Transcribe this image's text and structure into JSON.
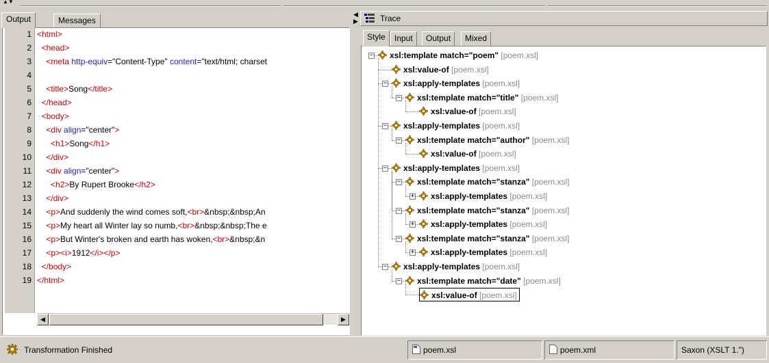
{
  "left_panel": {
    "tabs": [
      {
        "label": "Output",
        "active": true
      },
      {
        "label": "Messages",
        "active": false
      }
    ],
    "line_numbers": [
      "1",
      "2",
      "3",
      "4",
      "5",
      "6",
      "7",
      "8",
      "9",
      "10",
      "11",
      "12",
      "13",
      "14",
      "15",
      "16",
      "17",
      "18",
      "19"
    ],
    "code_lines": [
      [
        [
          "tg",
          "<html>"
        ]
      ],
      [
        [
          "tx",
          "  "
        ],
        [
          "tg",
          "<head>"
        ]
      ],
      [
        [
          "tx",
          "    "
        ],
        [
          "tg",
          "<meta "
        ],
        [
          "at",
          "http-equiv"
        ],
        [
          "tx",
          "=\"Content-Type\" "
        ],
        [
          "at",
          "content"
        ],
        [
          "tx",
          "=\"text/html; charset"
        ]
      ],
      [
        [
          "tx",
          ""
        ]
      ],
      [
        [
          "tx",
          "    "
        ],
        [
          "tg",
          "<title>"
        ],
        [
          "tx",
          "Song"
        ],
        [
          "tg",
          "</title>"
        ]
      ],
      [
        [
          "tx",
          "  "
        ],
        [
          "tg",
          "</head>"
        ]
      ],
      [
        [
          "tx",
          "  "
        ],
        [
          "tg",
          "<body>"
        ]
      ],
      [
        [
          "tx",
          "    "
        ],
        [
          "tg",
          "<div "
        ],
        [
          "at",
          "align"
        ],
        [
          "tx",
          "=\"center\""
        ],
        [
          "tg",
          ">"
        ]
      ],
      [
        [
          "tx",
          "      "
        ],
        [
          "tg",
          "<h1>"
        ],
        [
          "tx",
          "Song"
        ],
        [
          "tg",
          "</h1>"
        ]
      ],
      [
        [
          "tx",
          "    "
        ],
        [
          "tg",
          "</div>"
        ]
      ],
      [
        [
          "tx",
          "    "
        ],
        [
          "tg",
          "<div "
        ],
        [
          "at",
          "align"
        ],
        [
          "tx",
          "=\"center\""
        ],
        [
          "tg",
          ">"
        ]
      ],
      [
        [
          "tx",
          "      "
        ],
        [
          "tg",
          "<h2>"
        ],
        [
          "tx",
          "By Rupert Brooke"
        ],
        [
          "tg",
          "</h2>"
        ]
      ],
      [
        [
          "tx",
          "    "
        ],
        [
          "tg",
          "</div>"
        ]
      ],
      [
        [
          "tx",
          "    "
        ],
        [
          "tg",
          "<p>"
        ],
        [
          "tx",
          "And suddenly the wind comes soft,"
        ],
        [
          "tg",
          "<br>"
        ],
        [
          "tx",
          "&nbsp;&nbsp;An"
        ]
      ],
      [
        [
          "tx",
          "    "
        ],
        [
          "tg",
          "<p>"
        ],
        [
          "tx",
          "My heart all Winter lay so numb,"
        ],
        [
          "tg",
          "<br>"
        ],
        [
          "tx",
          "&nbsp;&nbsp;The e"
        ]
      ],
      [
        [
          "tx",
          "    "
        ],
        [
          "tg",
          "<p>"
        ],
        [
          "tx",
          "But Winter's broken and earth has woken,"
        ],
        [
          "tg",
          "<br>"
        ],
        [
          "tx",
          "&nbsp;&n"
        ]
      ],
      [
        [
          "tx",
          "    "
        ],
        [
          "tg",
          "<p><i>"
        ],
        [
          "tx",
          "1912"
        ],
        [
          "tg",
          "</i></p>"
        ]
      ],
      [
        [
          "tx",
          "  "
        ],
        [
          "tg",
          "</body>"
        ]
      ],
      [
        [
          "tg",
          "</html>"
        ]
      ]
    ],
    "scroll_left_icon": "scroll-left-icon",
    "scroll_right_icon": "scroll-right-icon"
  },
  "right_panel": {
    "title": "Trace",
    "title_icon": "trace-tree-icon",
    "tabs": [
      {
        "label": "Style",
        "active": true
      },
      {
        "label": "Input",
        "active": false
      },
      {
        "label": "Output",
        "active": false
      },
      {
        "label": "Mixed",
        "active": false
      }
    ],
    "tree": [
      {
        "depth": 0,
        "expander": "minus",
        "label": "xsl:template match=\"poem\"",
        "src": "[poem.xsl]"
      },
      {
        "depth": 1,
        "expander": "none",
        "label": "xsl:value-of",
        "src": "[poem.xsl]"
      },
      {
        "depth": 1,
        "expander": "minus",
        "label": "xsl:apply-templates",
        "src": "[poem.xsl]"
      },
      {
        "depth": 2,
        "expander": "minus",
        "label": "xsl:template match=\"title\"",
        "src": "[poem.xsl]"
      },
      {
        "depth": 3,
        "expander": "none",
        "label": "xsl:value-of",
        "src": "[poem.xsl]"
      },
      {
        "depth": 1,
        "expander": "minus",
        "label": "xsl:apply-templates",
        "src": "[poem.xsl]"
      },
      {
        "depth": 2,
        "expander": "minus",
        "label": "xsl:template match=\"author\"",
        "src": "[poem.xsl]"
      },
      {
        "depth": 3,
        "expander": "none",
        "label": "xsl:value-of",
        "src": "[poem.xsl]"
      },
      {
        "depth": 1,
        "expander": "minus",
        "label": "xsl:apply-templates",
        "src": "[poem.xsl]"
      },
      {
        "depth": 2,
        "expander": "minus",
        "label": "xsl:template match=\"stanza\"",
        "src": "[poem.xsl]"
      },
      {
        "depth": 3,
        "expander": "plus",
        "label": "xsl:apply-templates",
        "src": "[poem.xsl]"
      },
      {
        "depth": 2,
        "expander": "minus",
        "label": "xsl:template match=\"stanza\"",
        "src": "[poem.xsl]"
      },
      {
        "depth": 3,
        "expander": "plus",
        "label": "xsl:apply-templates",
        "src": "[poem.xsl]"
      },
      {
        "depth": 2,
        "expander": "minus",
        "label": "xsl:template match=\"stanza\"",
        "src": "[poem.xsl]"
      },
      {
        "depth": 3,
        "expander": "plus",
        "label": "xsl:apply-templates",
        "src": "[poem.xsl]"
      },
      {
        "depth": 1,
        "expander": "minus",
        "label": "xsl:apply-templates",
        "src": "[poem.xsl]"
      },
      {
        "depth": 2,
        "expander": "minus",
        "label": "xsl:template match=\"date\"",
        "src": "[poem.xsl]"
      },
      {
        "depth": 3,
        "expander": "none",
        "label": "xsl:value-of",
        "src": "[poem.xsl]",
        "selected": true
      }
    ],
    "node_icon": "gear-icon"
  },
  "status_bar": {
    "status_icon": "gear-icon",
    "message": "Transformation Finished",
    "stylesheet_icon": "xsl-file-icon",
    "stylesheet": "poem.xsl",
    "xml_icon": "xml-file-icon",
    "xml": "poem.xml",
    "processor": "Saxon (XSLT 1.\")"
  },
  "colors": {
    "chrome": "#d4d0c8",
    "tag": "#d00000",
    "attribute": "#1e1ec8",
    "source_ref": "#8a8a8a",
    "gear": "#c08a10"
  }
}
